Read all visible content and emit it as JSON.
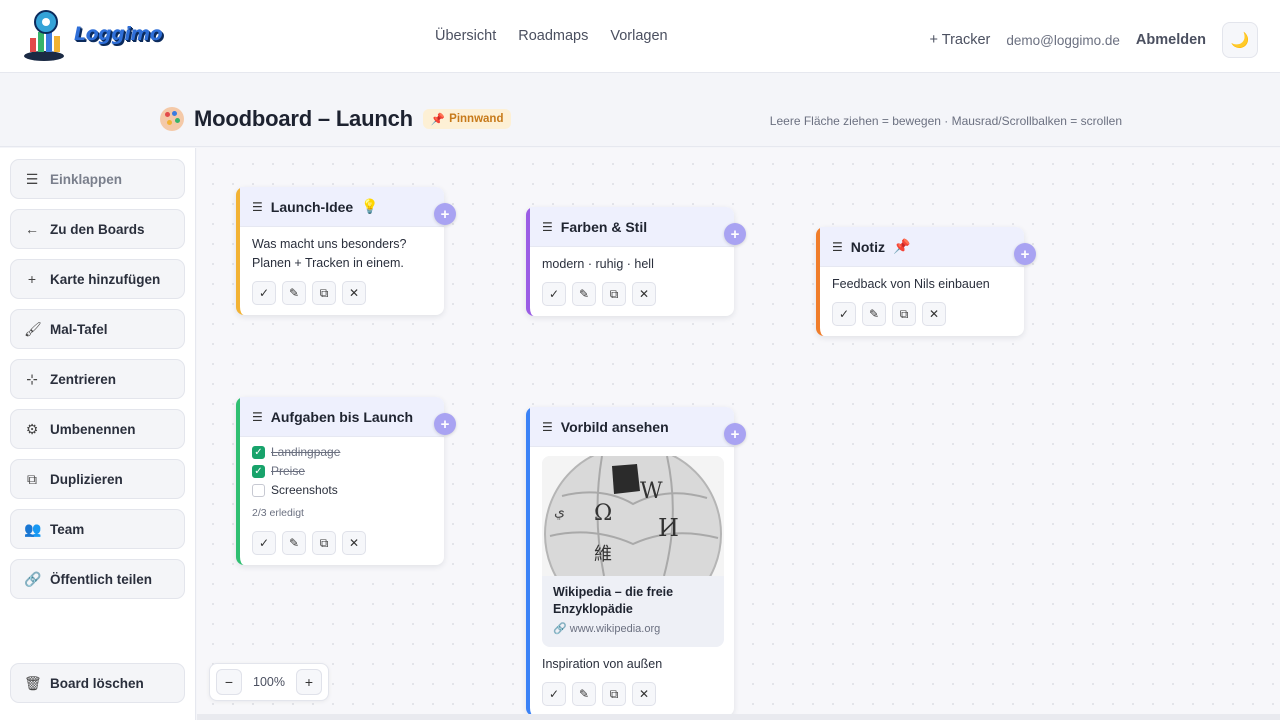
{
  "brand": {
    "logo_text": "Loggimo"
  },
  "nav": {
    "links": [
      "Übersicht",
      "Roadmaps",
      "Vorlagen"
    ],
    "tracker_label": "+ Tracker",
    "email": "demo@loggimo.de",
    "logout_label": "Abmelden",
    "theme_icon": "🌙"
  },
  "header": {
    "title": "Moodboard – Launch",
    "badge_icon": "📌",
    "badge": "Pinnwand",
    "hint": "Leere Fläche ziehen = bewegen · Mausrad/Scrollbalken = scrollen"
  },
  "sidebar": {
    "items": [
      {
        "icon": "☰",
        "label": "Einklappen"
      },
      {
        "icon": "←",
        "label": "Zu den Boards"
      },
      {
        "icon": "+",
        "label": "Karte hinzufügen"
      },
      {
        "icon": "🖌",
        "label": "Mal-Tafel"
      },
      {
        "icon": "⊹",
        "label": "Zentrieren"
      },
      {
        "icon": "⚙",
        "label": "Umbenennen"
      },
      {
        "icon": "⧉",
        "label": "Duplizieren"
      },
      {
        "icon": "👥",
        "label": "Team"
      },
      {
        "icon": "🔗",
        "label": "Öffentlich teilen"
      }
    ],
    "delete": {
      "icon": "🗑",
      "label": "Board löschen"
    }
  },
  "cards": {
    "launch": {
      "title": "Launch-Idee",
      "emoji": "💡",
      "text_1": "Was macht uns besonders?",
      "text_2": "Planen + Tracken in einem.",
      "accent": "#f2b233"
    },
    "farben": {
      "title": "Farben & Stil",
      "text": "modern · ruhig · hell",
      "accent": "#9b5de5"
    },
    "notiz": {
      "title": "Notiz",
      "emoji": "📌",
      "text": "Feedback von Nils einbauen",
      "accent": "#f07d2a"
    },
    "aufgaben": {
      "title": "Aufgaben bis Launch",
      "items": [
        {
          "label": "Landingpage",
          "done": true
        },
        {
          "label": "Preise",
          "done": true
        },
        {
          "label": "Screenshots",
          "done": false
        }
      ],
      "progress": "2/3 erledigt",
      "accent": "#2fbf71"
    },
    "vorbild": {
      "title": "Vorbild ansehen",
      "link_title": "Wikipedia – die freie Enzyklopädie",
      "link_url": "www.wikipedia.org",
      "text": "Inspiration von außen",
      "accent": "#3b82f6"
    }
  },
  "card_actions": {
    "check": "✓",
    "edit": "✎",
    "duplicate": "⧉",
    "delete": "✕",
    "add": "+"
  },
  "zoom": {
    "minus": "−",
    "value": "100%",
    "plus": "+"
  }
}
